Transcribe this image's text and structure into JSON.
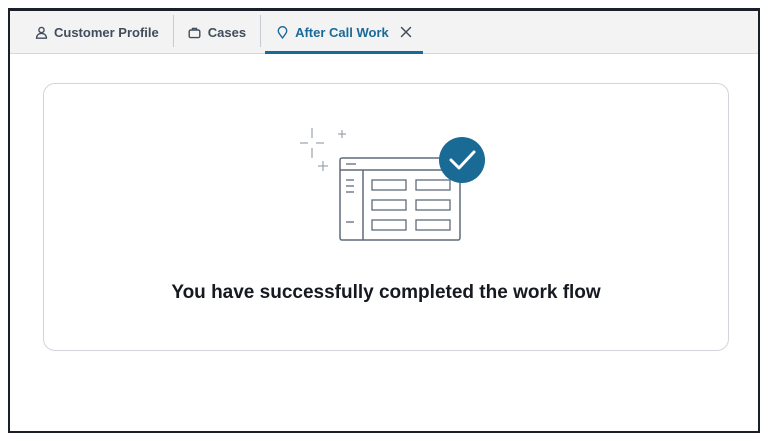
{
  "tabs": [
    {
      "id": "customer-profile",
      "label": "Customer Profile",
      "icon": "user-icon",
      "active": false
    },
    {
      "id": "cases",
      "label": "Cases",
      "icon": "briefcase-icon",
      "active": false
    },
    {
      "id": "after-call-work",
      "label": "After Call Work",
      "icon": "map-pin-icon",
      "active": true,
      "closable": true
    }
  ],
  "main": {
    "message": "You have successfully completed the work flow",
    "illustration_icon": "completed-table-check-icon"
  },
  "colors": {
    "accent": "#1a6a96",
    "tab_text": "#414d5c",
    "tabbar_bg": "#f3f3f3",
    "card_border": "#d1d5db"
  }
}
